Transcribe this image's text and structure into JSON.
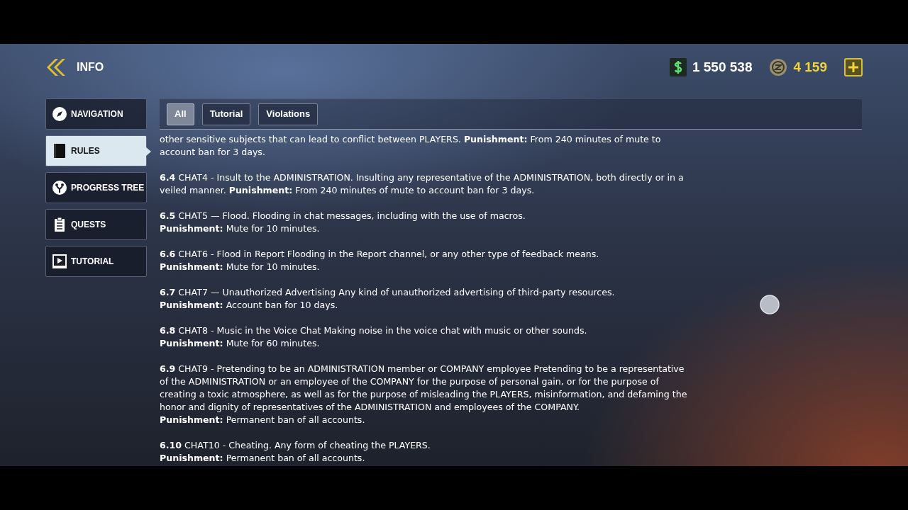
{
  "header": {
    "title": "INFO",
    "money": "1 550 538",
    "coins": "4 159"
  },
  "sidebar": {
    "items": [
      {
        "label": "NAVIGATION",
        "selected": false
      },
      {
        "label": "RULES",
        "selected": true
      },
      {
        "label": "PROGRESS TREE",
        "selected": false
      },
      {
        "label": "QUESTS",
        "selected": false
      },
      {
        "label": "TUTORIAL",
        "selected": false
      }
    ]
  },
  "tabs": [
    {
      "label": "All",
      "selected": true
    },
    {
      "label": "Tutorial",
      "selected": false
    },
    {
      "label": "Violations",
      "selected": false
    }
  ],
  "rules": [
    {
      "lines": [
        "other sensitive subjects that can lead to conflict between PLAYERS. **Punishment:** From 240 minutes of mute to account ban for 3 days."
      ]
    },
    {
      "lines": [
        "**6.4** CHAT4 - Insult to the ADMINISTRATION. Insulting any representative of the ADMINISTRATION, both directly or in a veiled manner. **Punishment:** From 240 minutes of mute to account ban for 3 days."
      ]
    },
    {
      "lines": [
        "**6.5** CHAT5 — Flood. Flooding in chat messages, including with the use of macros.",
        "**Punishment:** Mute for 10 minutes."
      ]
    },
    {
      "lines": [
        "**6.6** CHAT6 - Flood in Report Flooding in the Report channel, or any other type of feedback means.",
        "**Punishment:** Mute for 10 minutes."
      ]
    },
    {
      "lines": [
        "**6.7** CHAT7 — Unauthorized Advertising Any kind of unauthorized advertising of third-party resources.",
        "**Punishment:** Account ban for 10 days."
      ]
    },
    {
      "lines": [
        "**6.8** CHAT8 - Music in the Voice Chat Making noise in the voice chat with music or other sounds.",
        "**Punishment:** Mute for 60 minutes."
      ]
    },
    {
      "lines": [
        "**6.9** CHAT9 - Pretending to be an ADMINISTRATION member or COMPANY employee Pretending to be a representative of the ADMINISTRATION or an employee of the COMPANY for the purpose of personal gain, or for the purpose of creating a toxic atmosphere, as well as for the purpose of misleading the PLAYERS, misinformation, and defaming the honor and dignity of representatives of the ADMINISTRATION and employees of the COMPANY.",
        "**Punishment:** Permanent ban of all accounts."
      ]
    },
    {
      "lines": [
        "**6.10** CHAT10 - Cheating. Any form of cheating the PLAYERS.",
        "**Punishment:** Permanent ban of all accounts."
      ]
    }
  ]
}
